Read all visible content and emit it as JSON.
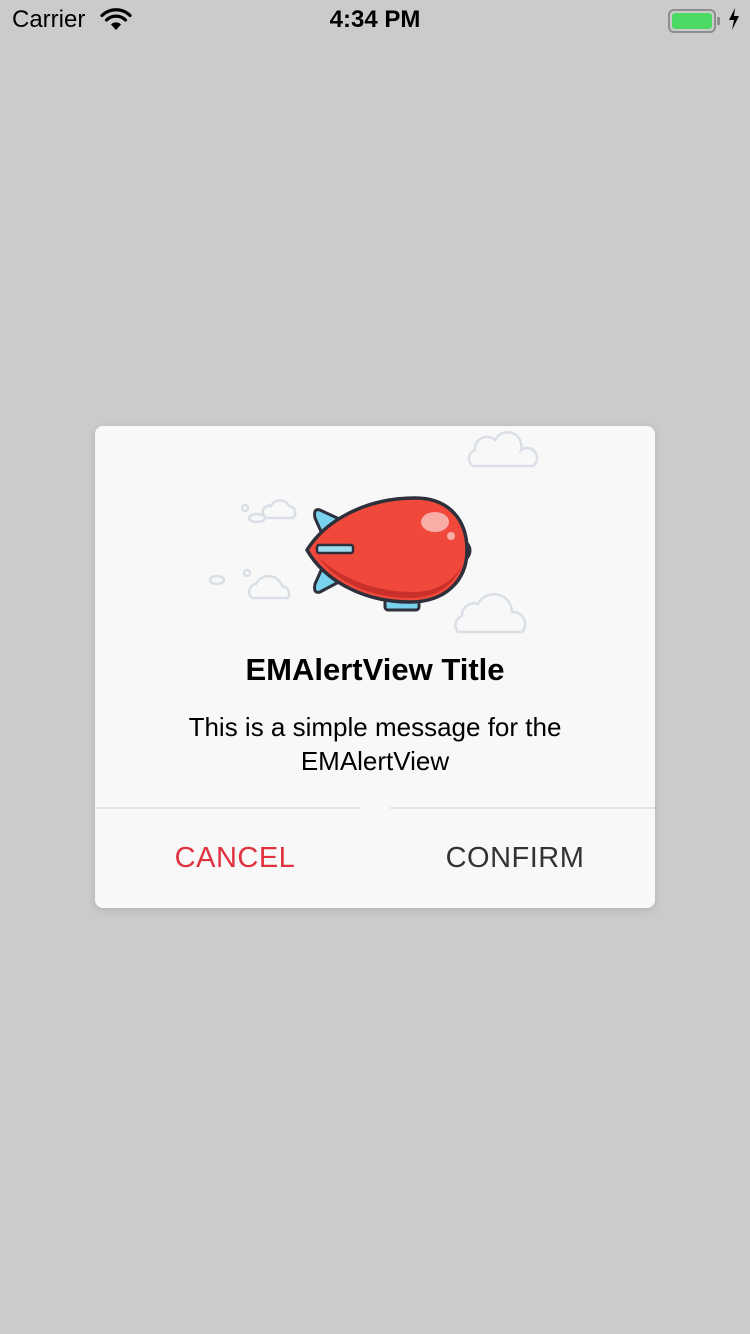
{
  "status_bar": {
    "carrier": "Carrier",
    "time": "4:34 PM",
    "battery_level": 1.0,
    "battery_color": "#4cd964"
  },
  "alert": {
    "title": "EMAlertView Title",
    "message": "This is a simple message for the EMAlertView",
    "cancel_label": "CANCEL",
    "confirm_label": "CONFIRM",
    "cancel_color": "#e0323f",
    "confirm_color": "#333333",
    "illustration": "airship-icon"
  }
}
